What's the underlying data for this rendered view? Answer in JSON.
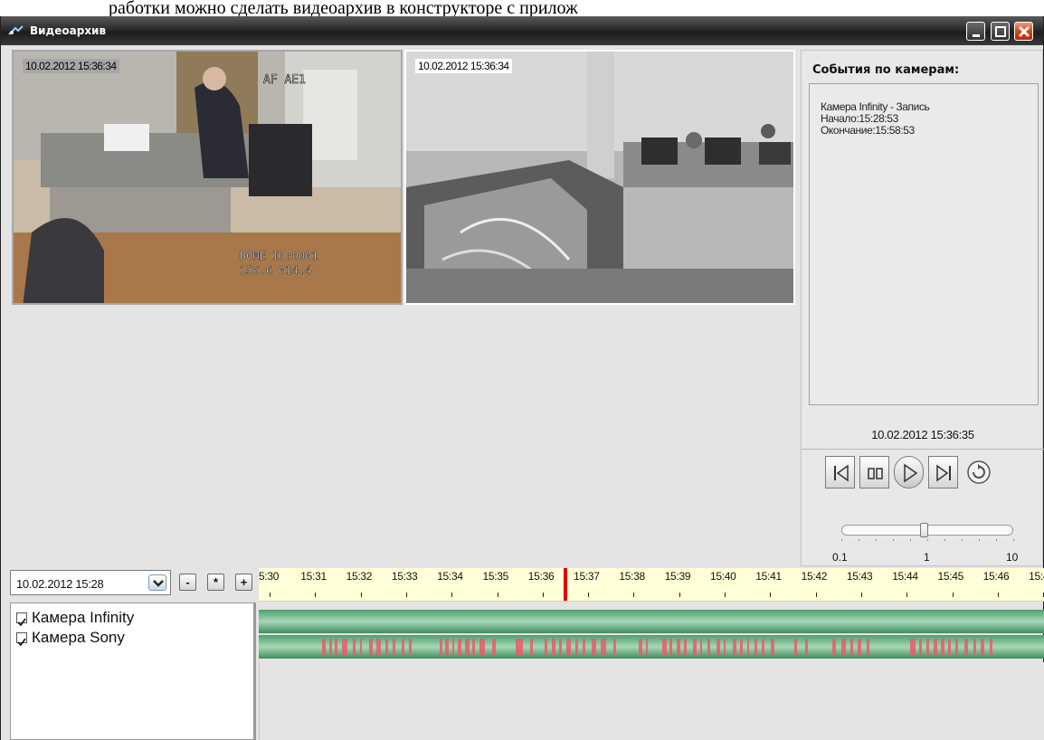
{
  "window": {
    "title": "Видеоархив",
    "caption_above": "работки можно сделать видеоархив в конструкторе с прилож"
  },
  "cameras": {
    "tile1": {
      "timestamp": "10.02.2012 15:36:34",
      "overlay_line1": "AF AE1",
      "overlay_line2": "DOME ID:0001",
      "overlay_line3": "156.6 014.4"
    },
    "tile2": {
      "timestamp": "10.02.2012 15:36:34"
    }
  },
  "events": {
    "title": "События по камерам:",
    "entries": [
      {
        "line1": "Камера Infinity - Запись",
        "line2": "Начало:15:28:53",
        "line3": "Окончание:15:58:53"
      }
    ]
  },
  "player": {
    "current_time": "10.02.2012 15:36:35",
    "speed_min": "0.1",
    "speed_mid": "1",
    "speed_max": "10",
    "speed_value": 1
  },
  "timeline": {
    "date_value": "10.02.2012 15:28",
    "zoom_out": "-",
    "zoom_reset": "*",
    "zoom_in": "+",
    "ticks": [
      "5:30",
      "15:31",
      "15:32",
      "15:33",
      "15:34",
      "15:35",
      "15:36",
      "15:37",
      "15:38",
      "15:39",
      "15:40",
      "15:41",
      "15:42",
      "15:43",
      "15:44",
      "15:45",
      "15:46",
      "15:4"
    ],
    "cameras": [
      {
        "name": "Камера Infinity",
        "checked": true
      },
      {
        "name": "Камера Sony",
        "checked": true
      }
    ]
  },
  "colors": {
    "accent_cursor": "#e00000",
    "track_green": "#4f9e6d",
    "record_red": "#ea5b6b",
    "ruler_bg": "#ffffd8"
  }
}
